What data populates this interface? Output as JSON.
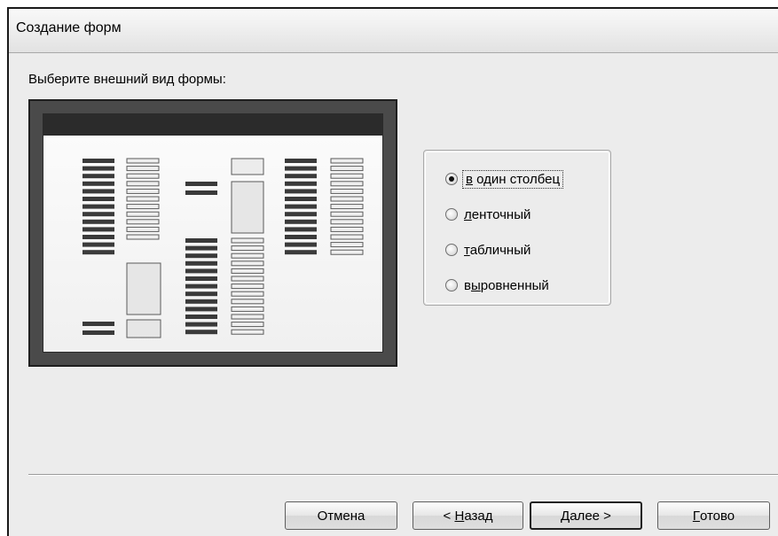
{
  "window": {
    "title": "Создание форм"
  },
  "prompt": "Выберите внешний вид формы:",
  "layout_options": [
    {
      "mnemonic": "в",
      "rest": " один столбец",
      "selected": true,
      "focused": true
    },
    {
      "mnemonic": "л",
      "rest": "енточный",
      "selected": false,
      "focused": false
    },
    {
      "mnemonic": "т",
      "rest": "абличный",
      "selected": false,
      "focused": false
    },
    {
      "pre": "в",
      "mnemonic": "ы",
      "rest": "ровненный",
      "selected": false,
      "focused": false
    }
  ],
  "buttons": {
    "cancel": "Отмена",
    "back_pre": "< ",
    "back_mnemonic": "Н",
    "back_rest": "азад",
    "next_mnemonic": "Д",
    "next_rest": "алее >",
    "finish_mnemonic": "Г",
    "finish_rest": "отово"
  },
  "colors": {
    "window_bg": "#ececec",
    "preview_frame": "#4a4a4a",
    "preview_header": "#2b2b2b"
  }
}
